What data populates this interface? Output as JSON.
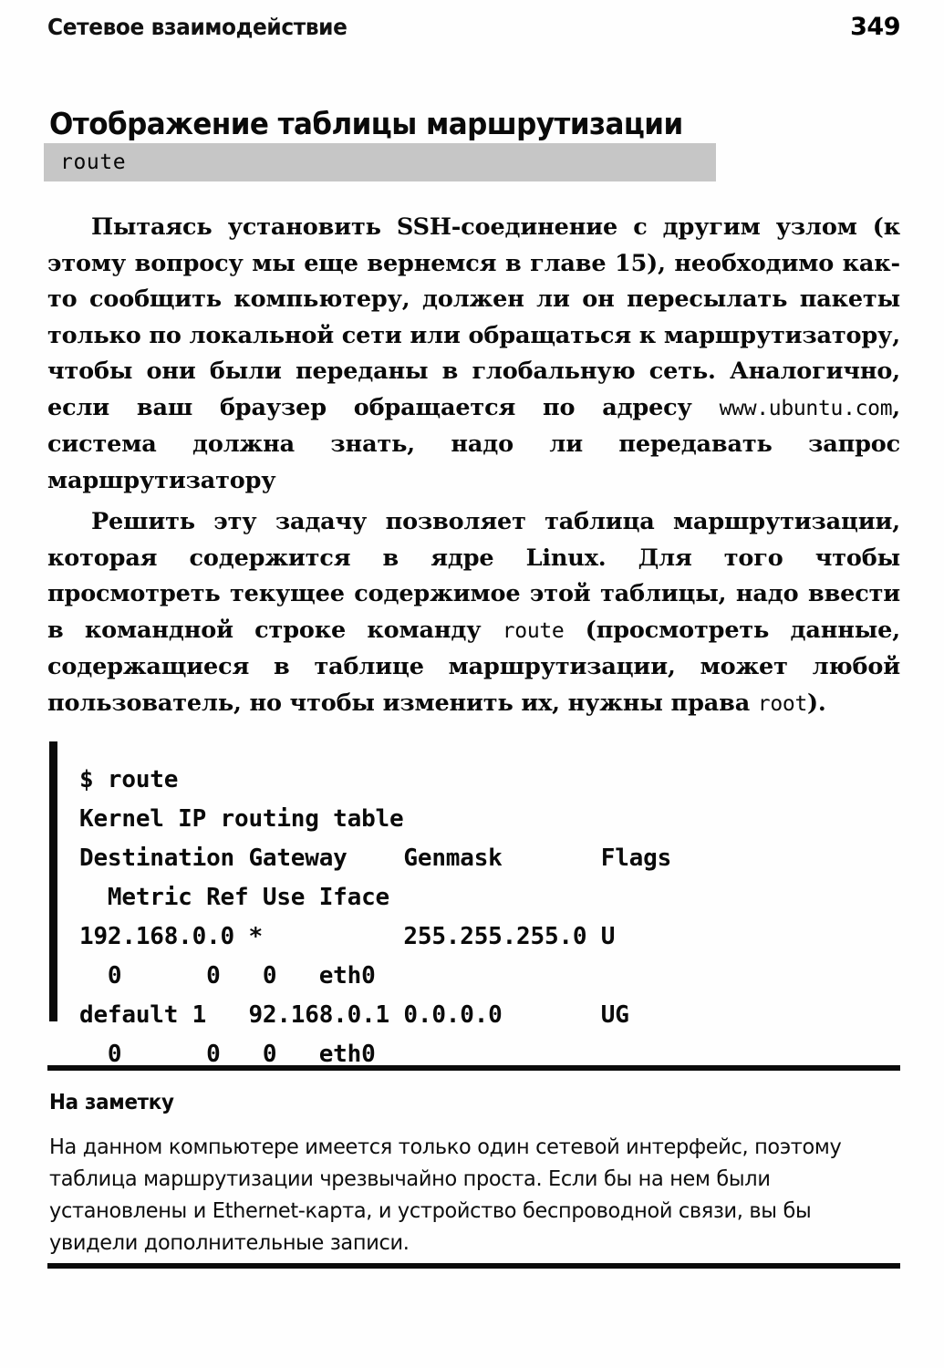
{
  "page": {
    "running_head": "Сетевое взаимодействие",
    "page_number": "349"
  },
  "section": {
    "heading": "Отображение таблицы маршрутизации",
    "syntax_box": "route"
  },
  "paragraphs": {
    "p1_part1": "Пытаясь установить SSH-соединение с другим узлом (к этому вопросу мы еще вернемся в главе 15),  необходимо как-то сообщить компьютеру, должен ли он пересылать пакеты только по локальной сети или обращаться к маршрутизатору, чтобы они были переданы в глобальную сеть. Аналогично, если ваш браузер обращается по адресу ",
    "p1_mono": "www.ubuntu.com",
    "p1_part2": ", система должна знать, надо ли передавать запрос маршрутизатору",
    "p2_part1": "Решить эту задачу позволяет таблица маршрутизации, которая содержится в ядре Linux. Для того чтобы просмотреть текущее содержимое этой таблицы, надо ввести в командной строке команду ",
    "p2_mono1": "route",
    "p2_part2": " (просмотреть данные, содержащиеся в таблице маршрутизации, может любой пользователь, но чтобы изменить их, нужны права ",
    "p2_mono2": "root",
    "p2_part3": ")."
  },
  "code_listing": {
    "lines": [
      "$ route",
      "Kernel IP routing table",
      "Destination Gateway    Genmask       Flags",
      "  Metric Ref Use Iface",
      "192.168.0.0 *          255.255.255.0 U",
      "  0      0   0   eth0",
      "default 1   92.168.0.1 0.0.0.0       UG",
      "  0      0   0   eth0"
    ],
    "text": "$ route\nKernel IP routing table\nDestination Gateway    Genmask       Flags\n  Metric Ref Use Iface\n192.168.0.0 *          255.255.255.0 U\n  0      0   0   eth0\ndefault 1   92.168.0.1 0.0.0.0       UG\n  0      0   0   eth0"
  },
  "note": {
    "heading": "На заметку",
    "body": "На данном компьютере имеется только один сетевой интерфейс, поэтому таблица маршрутизации чрезвычайно проста. Если бы на нем были установлены и Ethernet-карта, и устройство беспроводной связи, вы бы увидели дополнительные записи."
  },
  "colors": {
    "text": "#0a0a0a",
    "syntax_box_background": "#c6c6c6",
    "rule": "#0b0b0b",
    "page_background": "#ffffff"
  }
}
